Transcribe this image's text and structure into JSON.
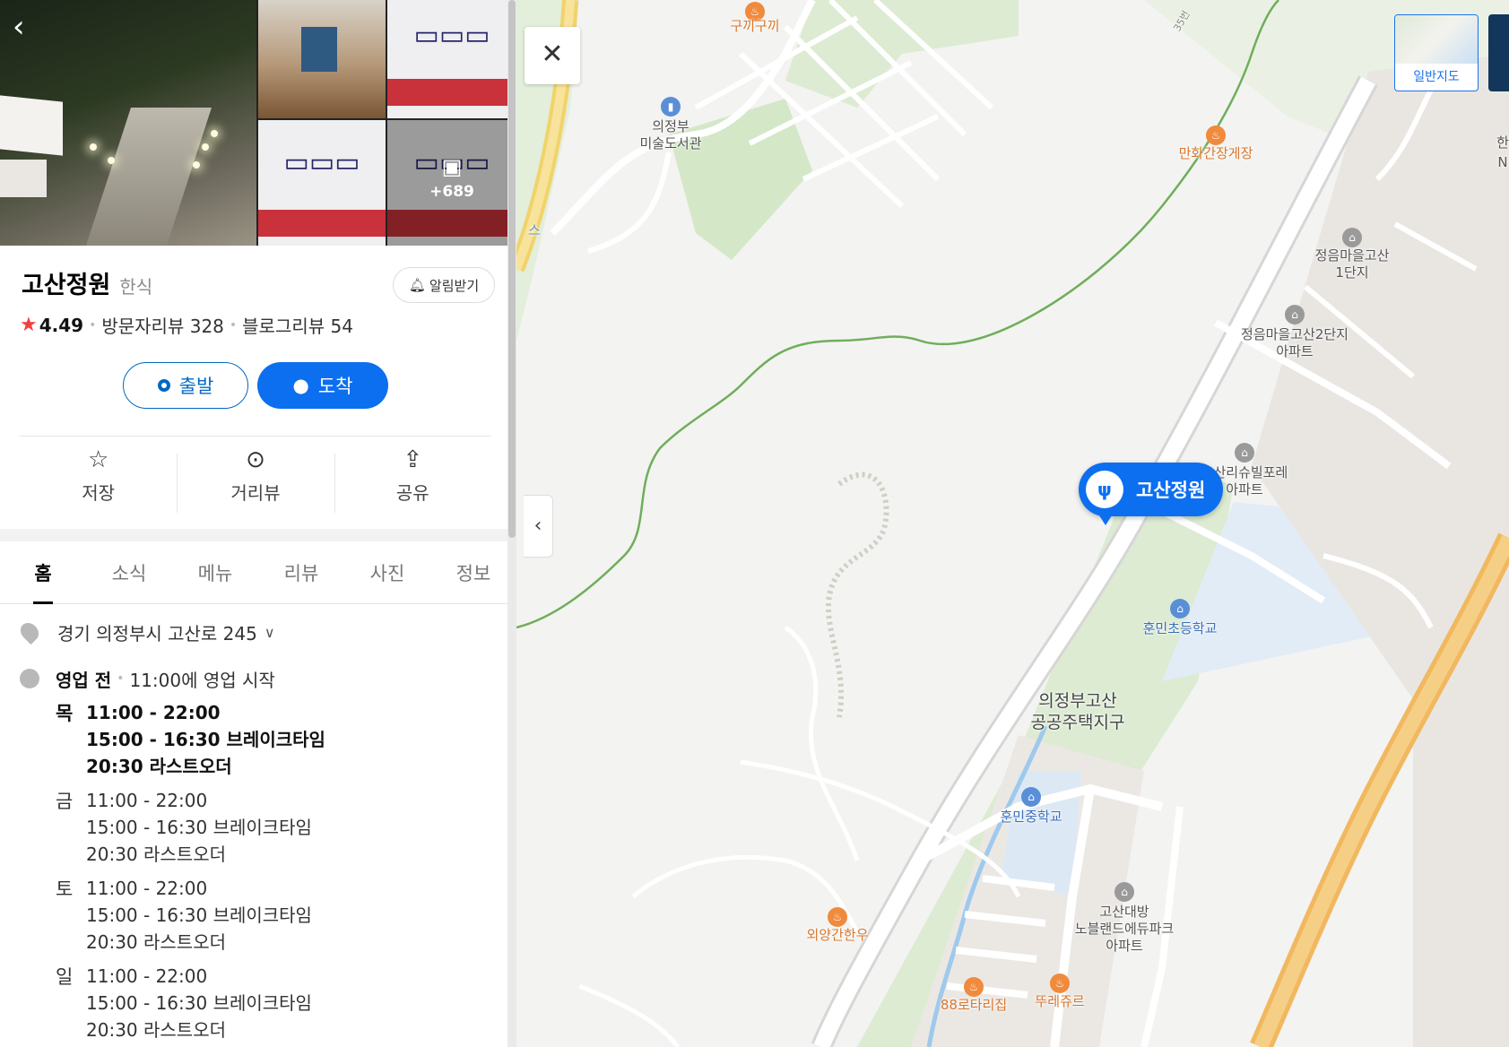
{
  "photos": {
    "more_count": "+689"
  },
  "place": {
    "name": "고산정원",
    "category": "한식"
  },
  "alarm": {
    "label": "알림받기"
  },
  "rating": {
    "score": "4.49",
    "visitor_reviews": "방문자리뷰 328",
    "blog_reviews": "블로그리뷰 54"
  },
  "route": {
    "start": "출발",
    "arrive": "도착"
  },
  "actions": [
    {
      "label": "저장"
    },
    {
      "label": "거리뷰"
    },
    {
      "label": "공유"
    }
  ],
  "tabs": [
    {
      "label": "홈"
    },
    {
      "label": "소식"
    },
    {
      "label": "메뉴"
    },
    {
      "label": "리뷰"
    },
    {
      "label": "사진"
    },
    {
      "label": "정보"
    }
  ],
  "address": {
    "text": "경기 의정부시 고산로 245"
  },
  "hours_summary": {
    "status": "영업 전",
    "detail": "11:00에 영업 시작"
  },
  "hours": [
    {
      "day": "목",
      "open": "11:00 - 22:00",
      "break": "15:00 - 16:30 브레이크타임",
      "last": "20:30 라스트오더"
    },
    {
      "day": "금",
      "open": "11:00 - 22:00",
      "break": "15:00 - 16:30 브레이크타임",
      "last": "20:30 라스트오더"
    },
    {
      "day": "토",
      "open": "11:00 - 22:00",
      "break": "15:00 - 16:30 브레이크타임",
      "last": "20:30 라스트오더"
    },
    {
      "day": "일",
      "open": "11:00 - 22:00",
      "break": "15:00 - 16:30 브레이크타임",
      "last": "20:30 라스트오더"
    }
  ],
  "map": {
    "marker_label": "고산정원",
    "map_type_label": "일반지도",
    "labels": {
      "gukki": "구끼구끼",
      "library": "의정부\n미술도서관",
      "manhwa": "만화간장게장",
      "jeongeum1": "정음마을고산\n1단지",
      "jeongeum2": "정음마을고산2단지\n아파트",
      "goshanri": "고산리슈빌포레\n아파트",
      "hunmin_elem": "훈민초등학교",
      "district": "의정부고산\n공공주택지구",
      "hunmin_mid": "훈민중학교",
      "daebang": "고산대방\n노블랜드에듀파크\n아파트",
      "oeyang": "외양간한우",
      "rotary": "88로타리집",
      "ddure": "뚜레쥬르",
      "bus": "스",
      "road35": "35번",
      "right_edge": "한",
      "right_edge2": "N"
    }
  }
}
